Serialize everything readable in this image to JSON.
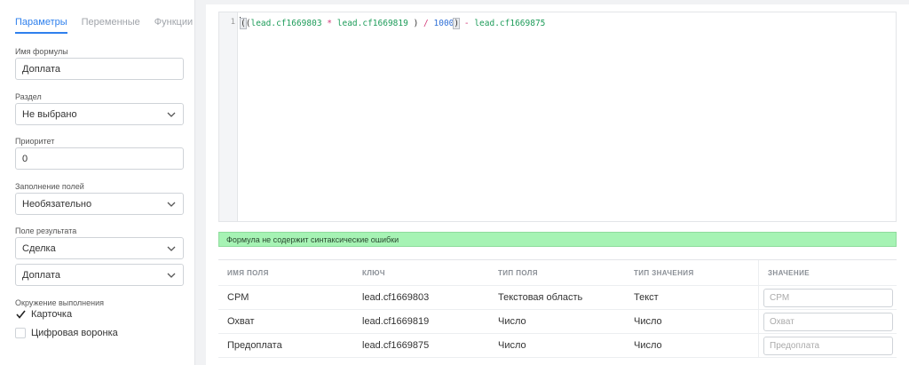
{
  "tabs": [
    {
      "label": "Параметры",
      "active": true
    },
    {
      "label": "Переменные",
      "active": false
    },
    {
      "label": "Функции",
      "active": false
    }
  ],
  "form": {
    "formula_name": {
      "label": "Имя формулы",
      "value": "Доплата"
    },
    "section": {
      "label": "Раздел",
      "value": "Не выбрано"
    },
    "priority": {
      "label": "Приоритет",
      "value": "0"
    },
    "fill_fields": {
      "label": "Заполнение полей",
      "value": "Необязательно"
    },
    "result_field": {
      "label": "Поле результата",
      "entity": "Сделка",
      "field": "Доплата"
    },
    "environment": {
      "label": "Окружение выполнения",
      "options": [
        {
          "label": "Карточка",
          "checked": true
        },
        {
          "label": "Цифровая воронка",
          "checked": false
        }
      ]
    }
  },
  "editor": {
    "line_number": "1",
    "tokens": {
      "open_outer": "(",
      "open_inner": "(",
      "var1": "lead.cf1669803",
      "op_mul": "*",
      "var2": "lead.cf1669819",
      "close_inner": ")",
      "op_div": "/",
      "num": "1000",
      "close_outer": ")",
      "op_minus": "-",
      "var3": "lead.cf1669875"
    }
  },
  "status": {
    "message": "Формула не содержит синтаксические ошибки",
    "color": "#a6f3b4"
  },
  "vars_table": {
    "headers": [
      "Имя поля",
      "Ключ",
      "Тип поля",
      "Тип значения",
      "Значение"
    ],
    "rows": [
      {
        "name": "CPM",
        "key": "lead.cf1669803",
        "field_type": "Текстовая область",
        "value_type": "Текст",
        "placeholder": "CPM"
      },
      {
        "name": "Охват",
        "key": "lead.cf1669819",
        "field_type": "Число",
        "value_type": "Число",
        "placeholder": "Охват"
      },
      {
        "name": "Предоплата",
        "key": "lead.cf1669875",
        "field_type": "Число",
        "value_type": "Число",
        "placeholder": "Предоплата"
      }
    ]
  },
  "colors": {
    "accent": "#2f80ed",
    "success_bg": "#a6f3b4",
    "variable": "#1e9c5a",
    "operator": "#d33c7a",
    "number": "#2f6fd6"
  },
  "icons": {
    "dropdown": "chevron-down-icon",
    "check": "checkmark-icon"
  }
}
